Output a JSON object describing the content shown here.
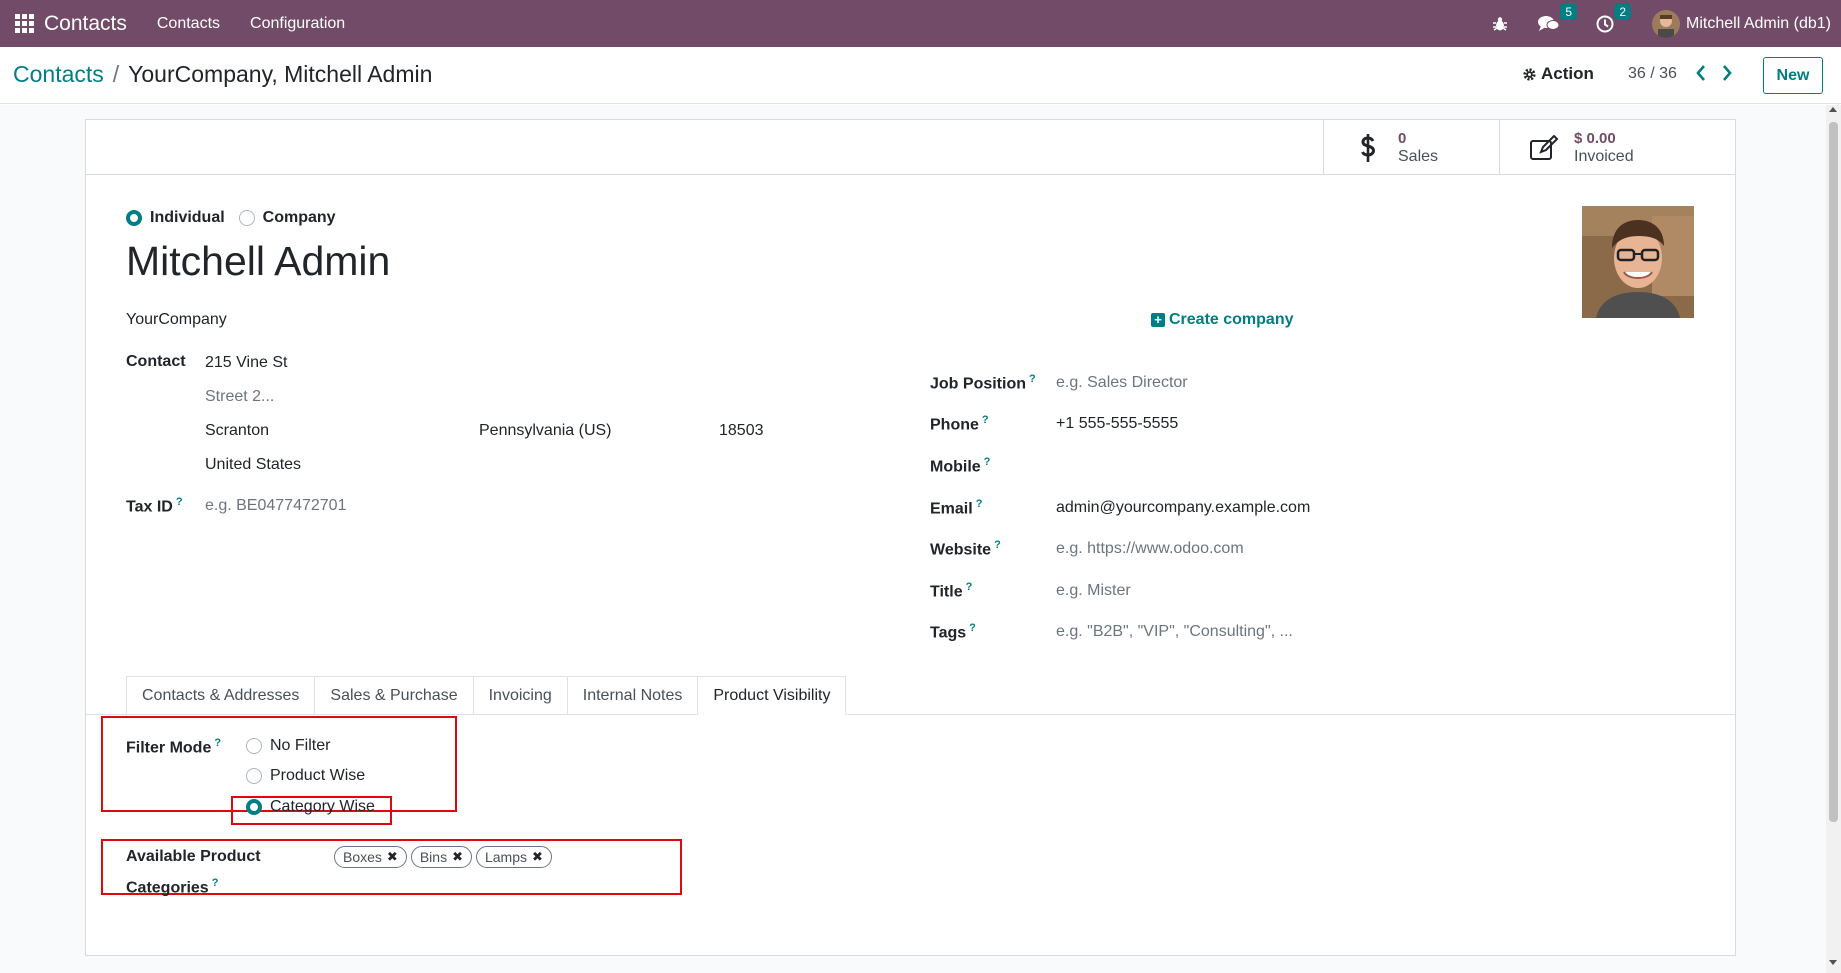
{
  "navbar": {
    "brand": "Contacts",
    "menu": [
      "Contacts",
      "Configuration"
    ],
    "messages_count": "5",
    "activities_count": "2",
    "user": "Mitchell Admin (db1)",
    "bg_color": "#714b67"
  },
  "control": {
    "breadcrumb_parent": "Contacts",
    "breadcrumb_sep": "/",
    "breadcrumb_current": "YourCompany, Mitchell Admin",
    "action_label": "Action",
    "pager": "36 / 36",
    "new_label": "New"
  },
  "stats": {
    "sales_value": "0",
    "sales_label": "Sales",
    "invoiced_value": "$ 0.00",
    "invoiced_label": "Invoiced"
  },
  "form": {
    "type_individual": "Individual",
    "type_company": "Company",
    "name": "Mitchell Admin",
    "company": "YourCompany",
    "create_company": "Create company",
    "contact_label": "Contact",
    "street": "215 Vine St",
    "street2_placeholder": "Street 2...",
    "city": "Scranton",
    "state": "Pennsylvania (US)",
    "zip": "18503",
    "country": "United States",
    "tax_id_label": "Tax ID",
    "tax_id_placeholder": "e.g. BE0477472701",
    "job_position_label": "Job Position",
    "job_position_placeholder": "e.g. Sales Director",
    "phone_label": "Phone",
    "phone": "+1 555-555-5555",
    "mobile_label": "Mobile",
    "email_label": "Email",
    "email": "admin@yourcompany.example.com",
    "website_label": "Website",
    "website_placeholder": "e.g. https://www.odoo.com",
    "title_label": "Title",
    "title_placeholder": "e.g. Mister",
    "tags_label": "Tags",
    "tags_placeholder": "e.g. \"B2B\", \"VIP\", \"Consulting\", ..."
  },
  "tabs": [
    "Contacts & Addresses",
    "Sales & Purchase",
    "Invoicing",
    "Internal Notes",
    "Product Visibility"
  ],
  "visibility": {
    "filter_mode_label": "Filter Mode",
    "options": [
      "No Filter",
      "Product Wise",
      "Category Wise"
    ],
    "selected": "Category Wise",
    "categories_label_line1": "Available Product",
    "categories_label_line2": "Categories",
    "categories": [
      "Boxes",
      "Bins",
      "Lamps"
    ]
  },
  "colors": {
    "accent": "#017e84",
    "brand": "#714b67",
    "highlight": "#e0070f"
  }
}
